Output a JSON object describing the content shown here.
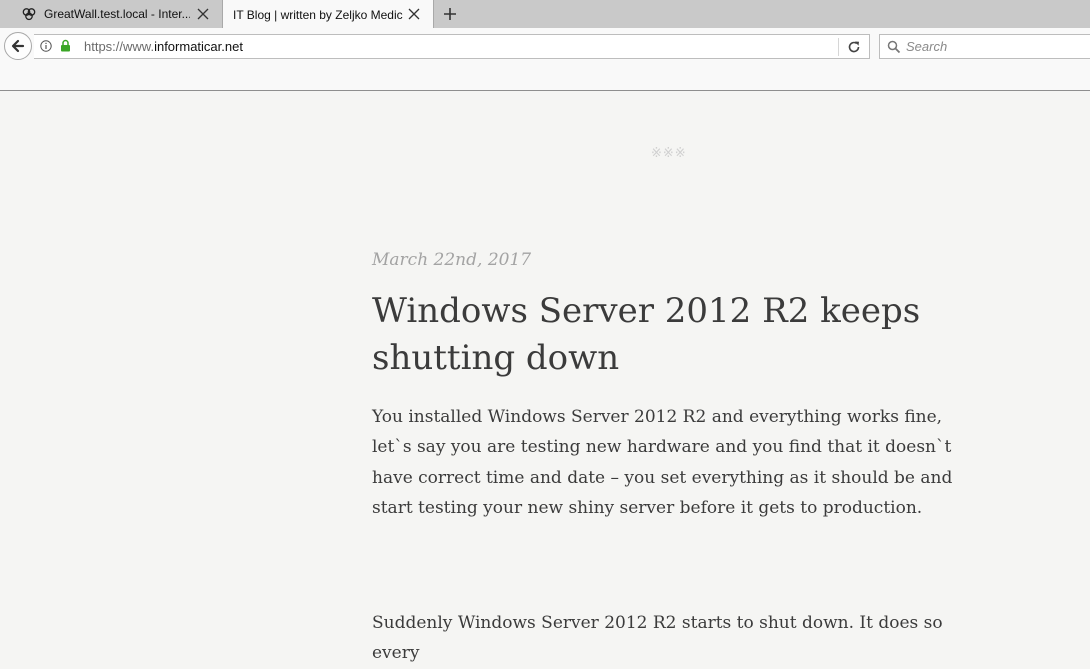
{
  "tabs": [
    {
      "label": "GreatWall.test.local - Inter..."
    },
    {
      "label": "IT Blog | written by Zeljko Medic"
    }
  ],
  "nav": {
    "url_scheme": "https://www.",
    "url_host": "informaticar.net",
    "search_placeholder": "Search"
  },
  "post": {
    "separator": "※※※",
    "date": "March 22nd, 2017",
    "title": "Windows Server 2012 R2 keeps shutting down",
    "paragraphs": [
      "You installed Windows Server 2012 R2 and everything works fine, let`s say you are testing new hardware and you find that it doesn`t have correct time and date – you set everything as it should be and start testing your new shiny server before it gets to production.",
      "Suddenly Windows Server 2012 R2 starts to shut down. It does so every"
    ]
  }
}
